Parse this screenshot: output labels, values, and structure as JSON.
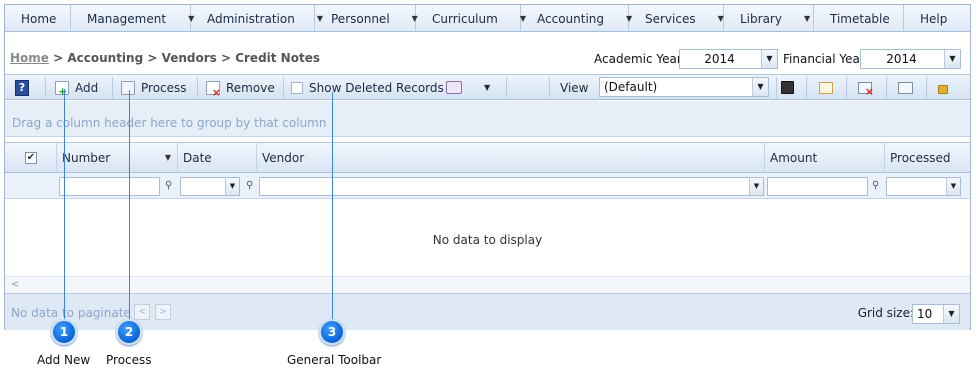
{
  "menu": [
    {
      "label": "Home",
      "caret": false
    },
    {
      "label": "Management",
      "caret": true
    },
    {
      "label": "Administration",
      "caret": true
    },
    {
      "label": "Personnel",
      "caret": true
    },
    {
      "label": "Curriculum",
      "caret": true
    },
    {
      "label": "Accounting",
      "caret": true
    },
    {
      "label": "Services",
      "caret": true
    },
    {
      "label": "Library",
      "caret": true
    },
    {
      "label": "Timetable",
      "caret": false
    },
    {
      "label": "Help",
      "caret": false
    }
  ],
  "breadcrumb": {
    "home": "Home",
    "rest": " > Accounting > Vendors > Credit Notes"
  },
  "academic_year": {
    "label": "Academic Year",
    "value": "2014"
  },
  "financial_year": {
    "label": "Financial Year",
    "value": "2014"
  },
  "toolbar": {
    "add": "Add",
    "process": "Process",
    "remove": "Remove",
    "show_deleted": "Show Deleted Records",
    "view_label": "View",
    "view_value": "(Default)"
  },
  "group_hint": "Drag a column header here to group by that column",
  "columns": [
    "Number",
    "Date",
    "Vendor",
    "Amount",
    "Processed"
  ],
  "no_data": "No data to display",
  "pager": {
    "text": "No data to paginate",
    "grid_size_label": "Grid size:",
    "grid_size": "10"
  },
  "callouts": [
    {
      "num": "1",
      "label": "Add New"
    },
    {
      "num": "2",
      "label": "Process"
    },
    {
      "num": "3",
      "label": "General Toolbar"
    }
  ],
  "colors": {
    "accent": "#0a63d6",
    "header": "#d9e5f4"
  }
}
